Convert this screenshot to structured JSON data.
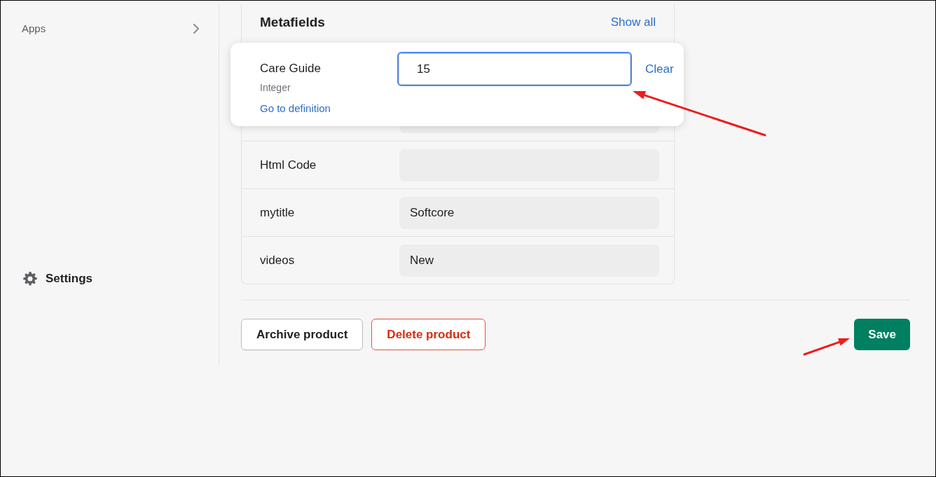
{
  "sidebar": {
    "items": [
      {
        "label": "Apps",
        "kind": "expandable"
      },
      {
        "label": "Settings",
        "kind": "settings"
      }
    ]
  },
  "metafields": {
    "title": "Metafields",
    "show_all": "Show all",
    "rows": [
      {
        "name": "Care Guide",
        "type": "Integer",
        "definition_link": "Go to definition",
        "value": "15",
        "clear": "Clear",
        "editing": true,
        "arrow_pointer": true
      },
      {
        "name": "Html Code",
        "editing": false
      },
      {
        "name": "mytitle",
        "value": "Softcore",
        "editing": false
      },
      {
        "name": "videos",
        "value": "New",
        "editing": false
      }
    ]
  },
  "actions": [
    {
      "label": "Archive product",
      "kind": "secondary"
    },
    {
      "label": "Delete product",
      "kind": "destructive"
    },
    {
      "label": "Save",
      "kind": "primary",
      "arrow_pointer": true
    }
  ]
}
